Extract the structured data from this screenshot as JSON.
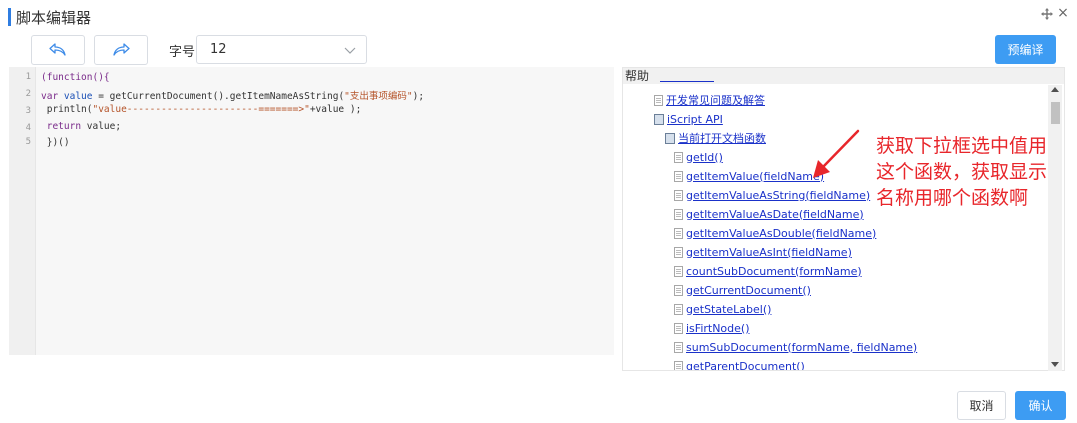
{
  "dialog": {
    "title": "脚本编辑器",
    "accent_color": "#2f7de1"
  },
  "toolbar": {
    "undo_icon": "undo-icon",
    "redo_icon": "redo-icon",
    "font_size_label": "字号",
    "font_size_value": "12",
    "precompile_label": "预编译"
  },
  "editor": {
    "line_numbers": [
      "1",
      "2",
      "3",
      "4",
      "5"
    ],
    "lines": [
      {
        "parts": [
          {
            "t": "(function(){",
            "c": "kw"
          }
        ]
      },
      {
        "parts": [
          {
            "t": "var ",
            "c": "kw"
          },
          {
            "t": "value",
            "c": "var"
          },
          {
            "t": " = getCurrentDocument().getItemNameAsString(",
            "c": ""
          },
          {
            "t": "\"支出事项编码\"",
            "c": "str"
          },
          {
            "t": ");",
            "c": ""
          }
        ]
      },
      {
        "parts": [
          {
            "t": " println(",
            "c": ""
          },
          {
            "t": "\"value-----------------------=======>\"",
            "c": "str"
          },
          {
            "t": "+value );",
            "c": ""
          }
        ]
      },
      {
        "parts": [
          {
            "t": " return ",
            "c": "kw"
          },
          {
            "t": "value;",
            "c": ""
          }
        ]
      },
      {
        "parts": [
          {
            "t": " })()",
            "c": ""
          }
        ]
      }
    ]
  },
  "help": {
    "header": "帮助",
    "items": [
      {
        "label": "开发常见问题及解答",
        "icon": "page-icon",
        "indent": 0
      },
      {
        "label": "iScript API",
        "icon": "book-icon",
        "indent": 0
      },
      {
        "label": "当前打开文档函数",
        "icon": "book-icon",
        "indent": 1
      },
      {
        "label": "getId()",
        "icon": "page-icon",
        "indent": 2
      },
      {
        "label": "getItemValue(fieldName)",
        "icon": "page-icon",
        "indent": 2
      },
      {
        "label": "getItemValueAsString(fieldName)",
        "icon": "page-icon",
        "indent": 2
      },
      {
        "label": "getItemValueAsDate(fieldName)",
        "icon": "page-icon",
        "indent": 2
      },
      {
        "label": "getItemValueAsDouble(fieldName)",
        "icon": "page-icon",
        "indent": 2
      },
      {
        "label": "getItemValueAsInt(fieldName)",
        "icon": "page-icon",
        "indent": 2
      },
      {
        "label": "countSubDocument(formName)",
        "icon": "page-icon",
        "indent": 2
      },
      {
        "label": "getCurrentDocument()",
        "icon": "page-icon",
        "indent": 2
      },
      {
        "label": "getStateLabel()",
        "icon": "page-icon",
        "indent": 2
      },
      {
        "label": "isFirtNode()",
        "icon": "page-icon",
        "indent": 2
      },
      {
        "label": "sumSubDocument(formName, fieldName)",
        "icon": "page-icon",
        "indent": 2
      },
      {
        "label": "getParentDocument()",
        "icon": "page-icon",
        "indent": 2
      }
    ]
  },
  "annotation": {
    "lines": [
      "获取下拉框选中值用",
      "这个函数，获取显示",
      "名称用哪个函数啊"
    ],
    "color": "#e8262b"
  },
  "footer": {
    "cancel_label": "取消",
    "confirm_label": "确认",
    "primary_color": "#3d9cf3"
  }
}
